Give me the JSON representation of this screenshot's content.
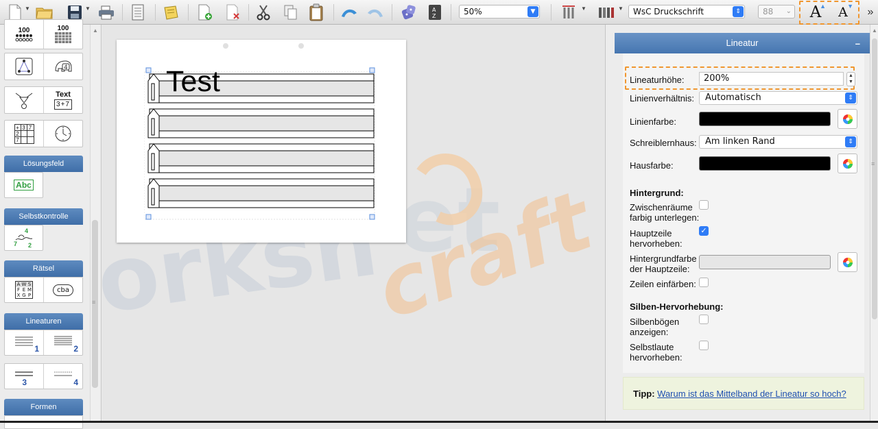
{
  "toolbar": {
    "zoom": "50%",
    "font": "WsC Druckschrift",
    "font_size": "88",
    "grow_label": "A",
    "shrink_label": "A",
    "overflow": "»"
  },
  "sidebar": {
    "number_grid_label": "100",
    "text_card_title": "Text",
    "text_card_sub": "3+7",
    "grid_cells": [
      "+",
      "3",
      "7",
      "2",
      "",
      "",
      "7",
      "",
      ""
    ],
    "sections": {
      "loesungsfeld": "Lösungsfeld",
      "selbstkontrolle": "Selbstkontrolle",
      "raetsel": "Rätsel",
      "lineaturen": "Lineaturen",
      "formen": "Formen"
    },
    "abc_label": "Abc",
    "selfcheck_nums": [
      "4",
      "7",
      "2"
    ],
    "puzzle_letters": [
      "A",
      "W",
      "S",
      "F",
      "E",
      "M",
      "X",
      "G",
      "P"
    ],
    "bubble_letters": "cba",
    "lineatur_numbers": [
      "1",
      "2",
      "3",
      "4"
    ]
  },
  "canvas": {
    "text": "Test",
    "watermark_dark": "orksh",
    "watermark_mid": "et",
    "watermark_light": "craft"
  },
  "panel": {
    "title": "Lineatur",
    "collapse": "–",
    "lineaturhoehe_label": "Lineaturhöhe:",
    "lineaturhoehe_value": "200%",
    "linienverhaeltnis_label": "Linienverhältnis:",
    "linienverhaeltnis_value": "Automatisch",
    "linienfarbe_label": "Linienfarbe:",
    "schreiblernhaus_label": "Schreiblernhaus:",
    "schreiblernhaus_value": "Am linken Rand",
    "hausfarbe_label": "Hausfarbe:",
    "hintergrund_title": "Hintergrund:",
    "zwischenraeume_label_1": "Zwischenräume",
    "zwischenraeume_label_2": "farbig unterlegen:",
    "hauptzeile_label_1": "Hauptzeile",
    "hauptzeile_label_2": "hervorheben:",
    "hintergrundfarbe_label_1": "Hintergrundfarbe",
    "hintergrundfarbe_label_2": "der Hauptzeile:",
    "zeilen_label": "Zeilen einfärben:",
    "silben_title": "Silben-Hervorhebung:",
    "silbenboegen_label_1": "Silbenbögen",
    "silbenboegen_label_2": "anzeigen:",
    "selbstlaute_label_1": "Selbstlaute",
    "selbstlaute_label_2": "hervorheben:",
    "tip_label": "Tipp:",
    "tip_link": "Warum ist das Mittelband der Lineatur so hoch?"
  },
  "colors": {
    "accent": "#2f7cf6",
    "panel_header": "#4676b0",
    "highlight_dash": "#f0962e",
    "line_color": "#000000",
    "house_color": "#000000",
    "main_line_bg": "#e6e6e6"
  }
}
